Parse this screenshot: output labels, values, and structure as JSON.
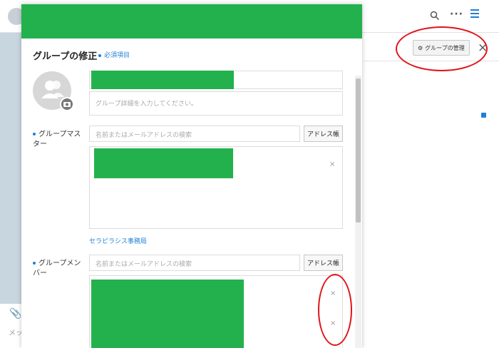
{
  "background": {
    "more_label": "···",
    "group_manage_label": "グループの管理",
    "close_label": "×",
    "attach_label": "📎",
    "message_label": "メッ"
  },
  "modal": {
    "title": "グループの修正",
    "required_note": "必須項目",
    "description_placeholder": "グループ詳細を入力してください。",
    "master": {
      "label": "グループマスター",
      "search_placeholder": "名前またはメールアドレスの検索",
      "address_book_label": "アドレス帳",
      "remove_label": "×",
      "department_link": "セラピラシス事務局"
    },
    "member": {
      "label": "グループメンバー",
      "search_placeholder": "名前またはメールアドレスの検索",
      "address_book_label": "アドレス帳",
      "remove_labels": [
        "×",
        "×"
      ]
    }
  },
  "colors": {
    "redaction_green": "#23b14d",
    "accent_blue": "#1e7fd6",
    "annotation_red": "#e0141b"
  }
}
